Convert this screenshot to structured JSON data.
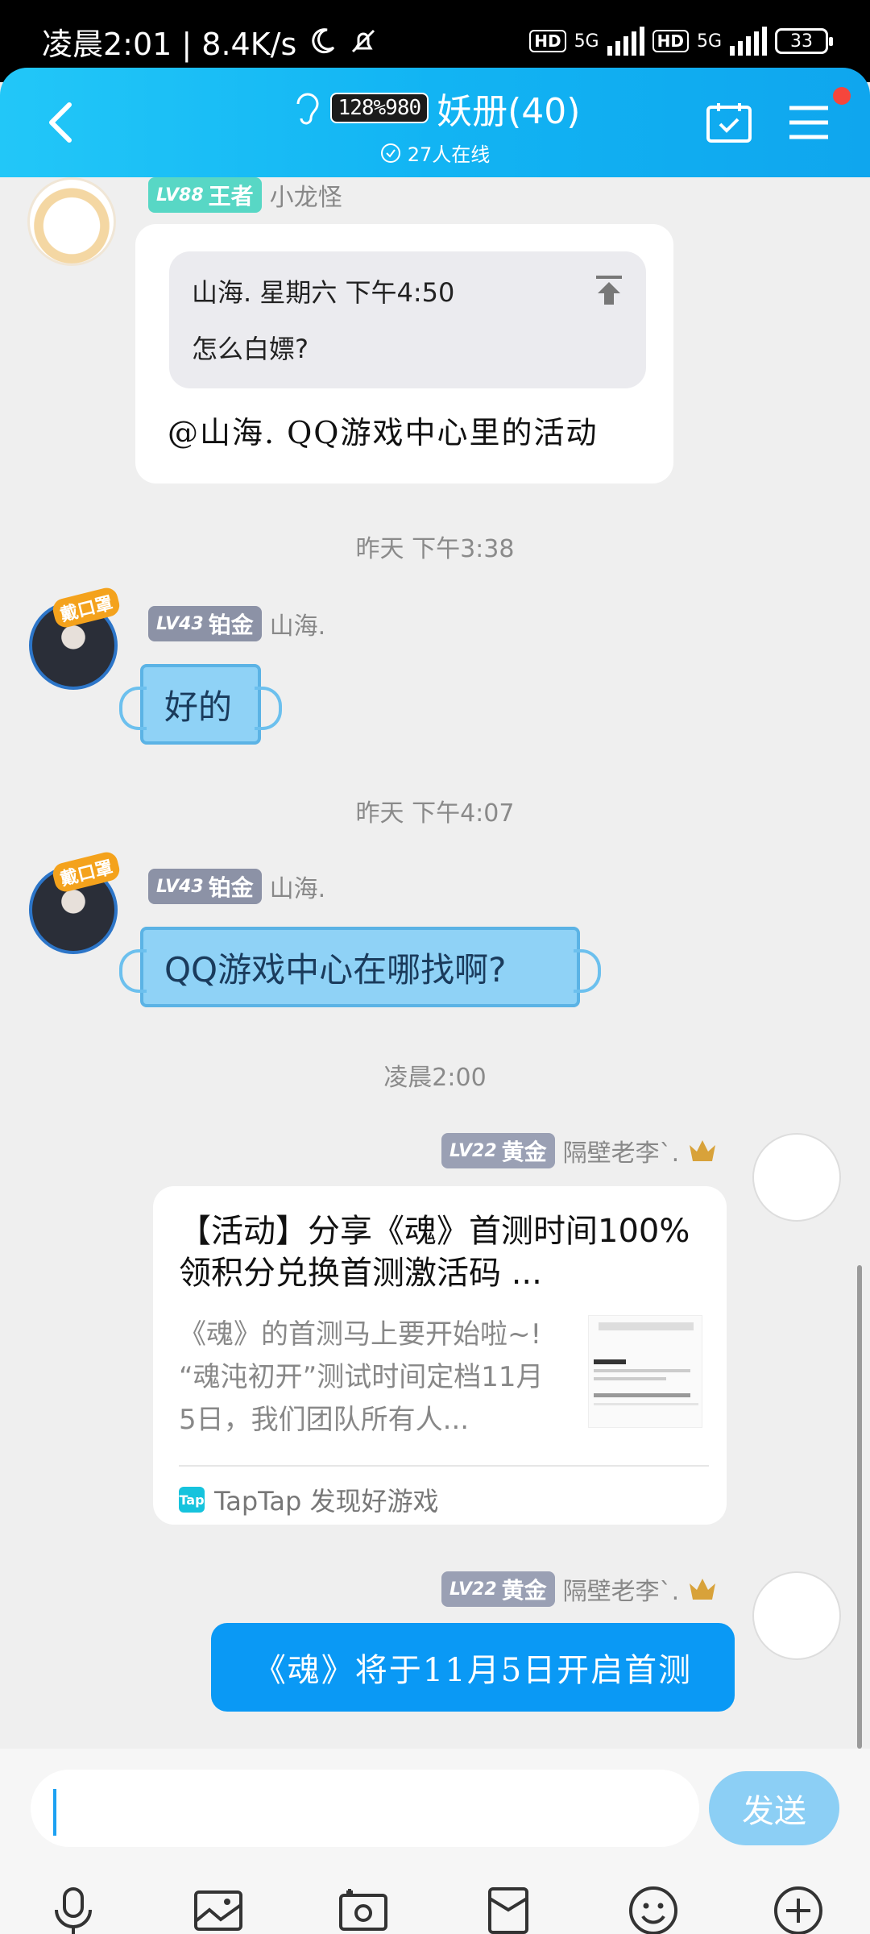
{
  "status_bar": {
    "time_speed": "凌晨2:01 | 8.4K/s",
    "network": "5G",
    "hd": "HD",
    "battery": "33"
  },
  "header": {
    "group_badge": "128%980",
    "title": "妖册(40)",
    "online": "27人在线"
  },
  "messages": {
    "m1": {
      "level": "LV88",
      "rank": "王者",
      "sender": "小龙怪",
      "quote_header": "山海. 星期六 下午4:50",
      "quote_body": "怎么白嫖?",
      "reply": "@山海. QQ游戏中心里的活动"
    },
    "time1": "昨天 下午3:38",
    "m2": {
      "level": "LV43",
      "rank": "铂金",
      "sender": "山海.",
      "tag": "戴口罩",
      "text": "好的"
    },
    "time2": "昨天 下午4:07",
    "m3": {
      "level": "LV43",
      "rank": "铂金",
      "sender": "山海.",
      "tag": "戴口罩",
      "text": "QQ游戏中心在哪找啊?"
    },
    "time3": "凌晨2:00",
    "m4": {
      "level": "LV22",
      "rank": "黄金",
      "sender": "隔壁老李`.",
      "card_title": "【活动】分享《魂》首测时间100%领积分兑换首测激活码 ...",
      "card_desc": "《魂》的首测马上要开始啦~! “魂沌初开”测试时间定档11月5日，我们团队所有人...",
      "card_source": "TapTap 发现好游戏",
      "tap_logo": "Tap"
    },
    "m5": {
      "level": "LV22",
      "rank": "黄金",
      "sender": "隔壁老李`.",
      "text": "《魂》将于11月5日开启首测"
    }
  },
  "input": {
    "send_label": "发送"
  },
  "colors": {
    "header_blue": "#12b4f3",
    "send_blue": "#8ccff5",
    "bubble_blue": "#0a99f5",
    "notification_red": "#f5463c"
  },
  "toolbar_icons": [
    "mic-icon",
    "image-icon",
    "camera-icon",
    "red-packet-icon",
    "emoji-icon",
    "plus-icon"
  ]
}
